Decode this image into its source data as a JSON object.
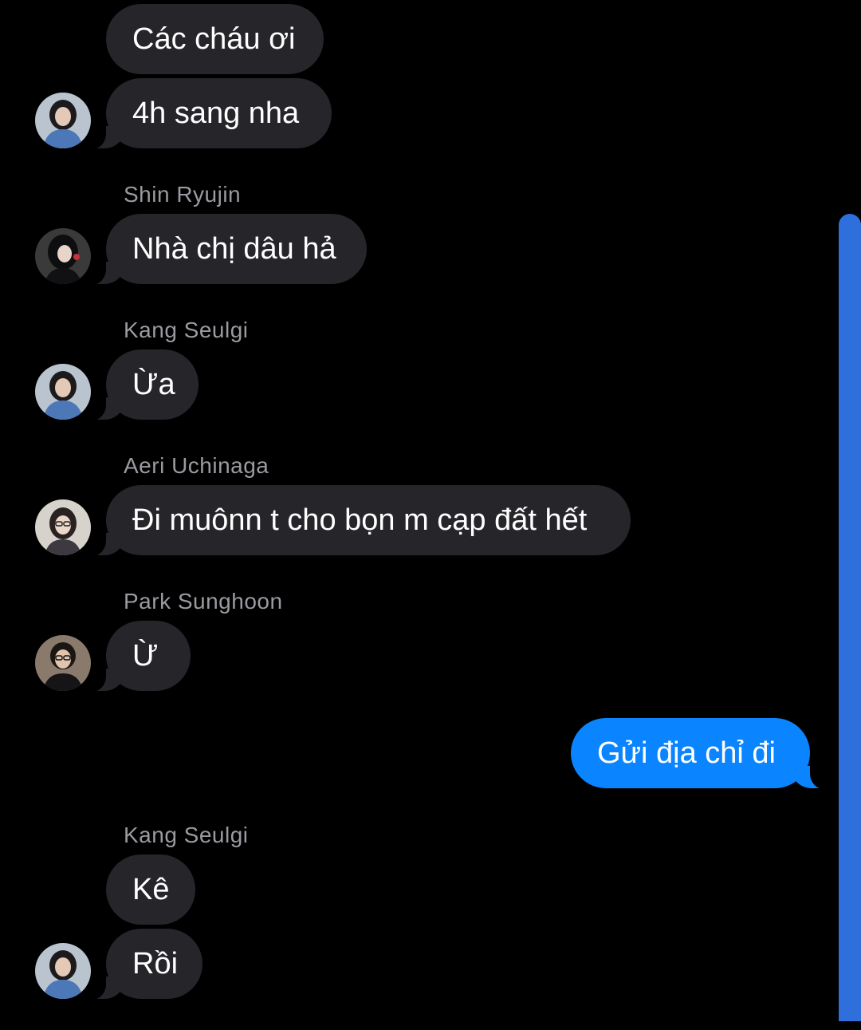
{
  "messages": [
    {
      "text": "Các cháu ơi"
    },
    {
      "text": "4h sang nha"
    },
    {
      "sender": "Shin Ryujin",
      "text": "Nhà chị dâu hả"
    },
    {
      "sender": "Kang Seulgi",
      "text": "Ừa"
    },
    {
      "sender": "Aeri Uchinaga",
      "text": "Đi muônn t cho bọn m cạp đất hết"
    },
    {
      "sender": "Park Sunghoon",
      "text": "Ừ"
    },
    {
      "text": "Gửi địa chỉ đi",
      "mine": true
    },
    {
      "sender": "Kang Seulgi",
      "text": "Kê"
    },
    {
      "text": "Rồi"
    }
  ],
  "colors": {
    "background": "#000000",
    "incoming_bubble": "#26252a",
    "outgoing_bubble": "#0a84ff",
    "sender_name": "#9a9aa0",
    "scrollbar": "#2f6fdc"
  },
  "icons": {
    "avatars": [
      "avatar-girl-blue-shirt",
      "avatar-girl-dark-hair",
      "avatar-girl-glasses",
      "avatar-boy-glasses"
    ]
  }
}
